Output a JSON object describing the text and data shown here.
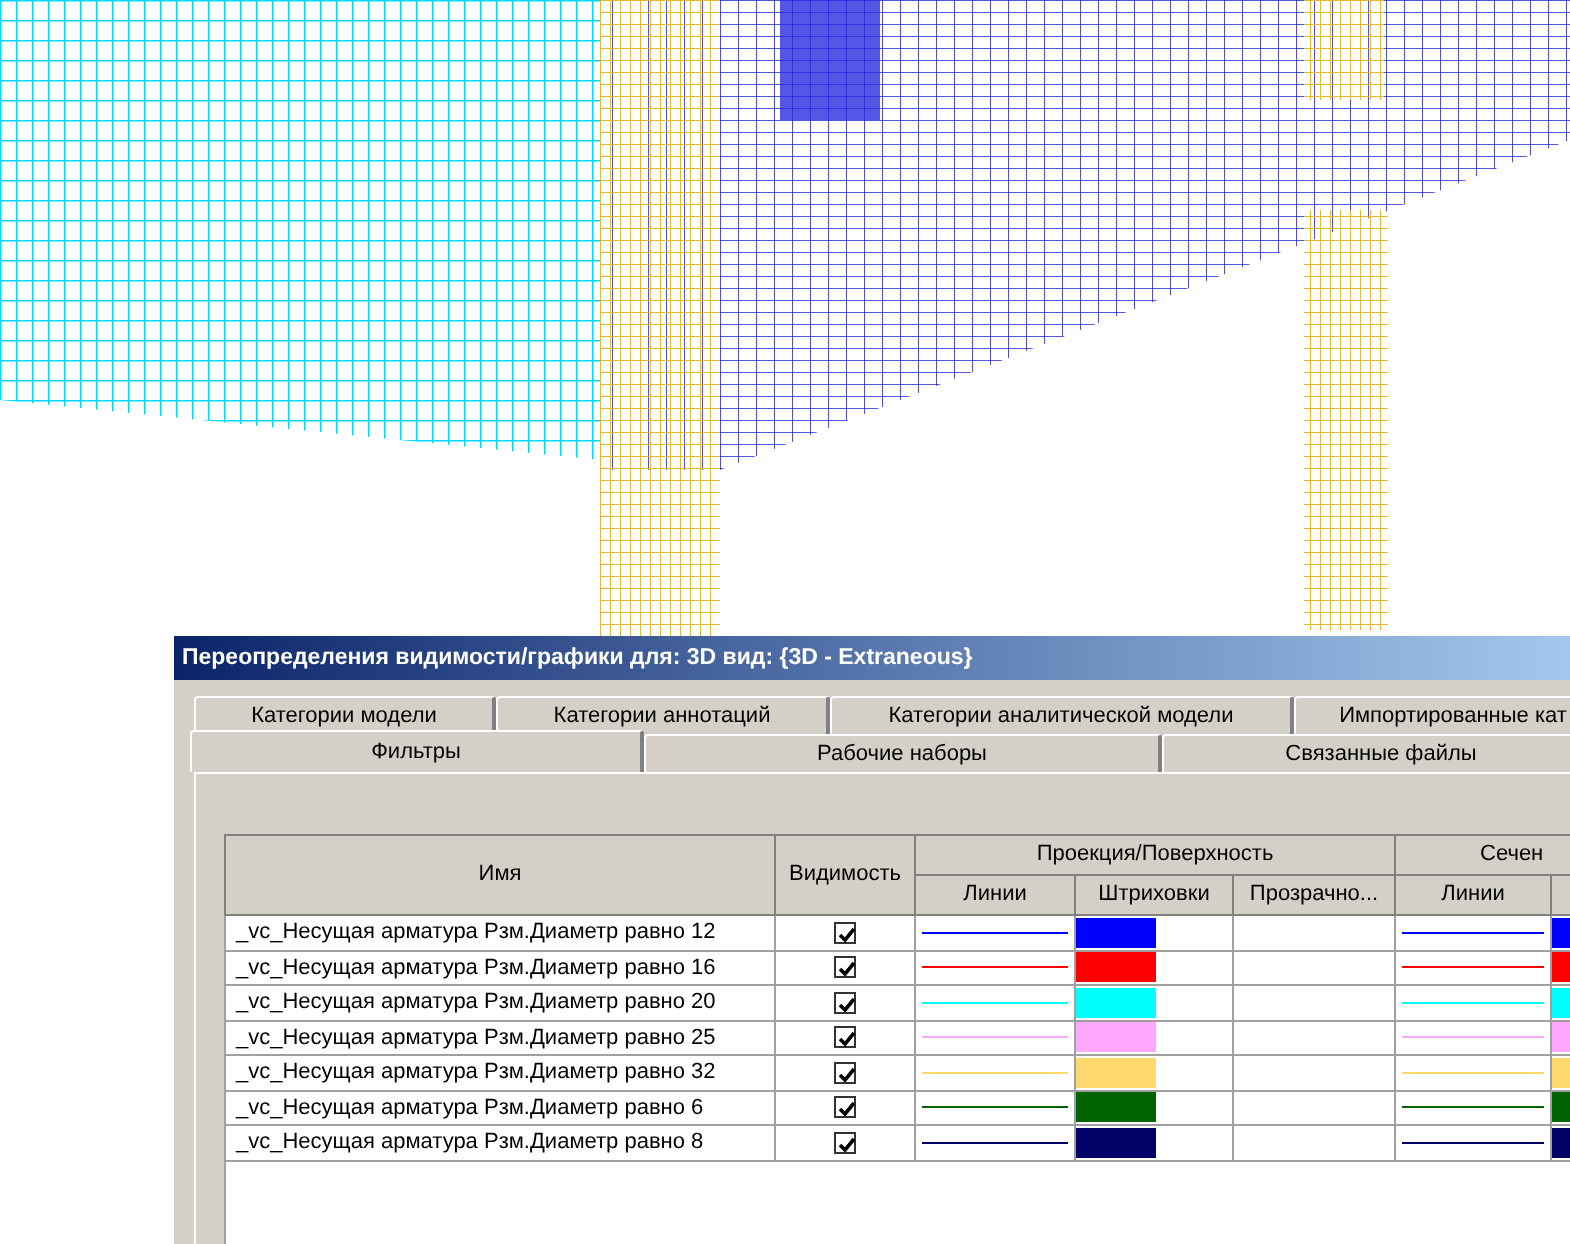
{
  "window": {
    "title": "Переопределения видимости/графики для: 3D вид: {3D - Extraneous}"
  },
  "tabs_row_1": [
    {
      "label": "Категории модели",
      "selected": false
    },
    {
      "label": "Категории аннотаций",
      "selected": false
    },
    {
      "label": "Категории аналитической модели",
      "selected": false
    },
    {
      "label": "Импортированные кат",
      "selected": false
    }
  ],
  "tabs_row_2": [
    {
      "label": "Фильтры",
      "selected": true
    },
    {
      "label": "Рабочие наборы",
      "selected": false
    },
    {
      "label": "Связанные файлы",
      "selected": false
    }
  ],
  "table": {
    "columns": {
      "name": "Имя",
      "visibility": "Видимость",
      "groups": [
        {
          "label": "Проекция/Поверхность",
          "subcolumns": [
            "Линии",
            "Штриховки",
            "Прозрачно..."
          ]
        },
        {
          "label": "Сечен",
          "subcolumns": [
            "Линии"
          ]
        }
      ]
    },
    "rows": [
      {
        "name": "_vc_Несущая арматура Рзм.Диаметр равно 12",
        "visible": true,
        "color": "#0000ff"
      },
      {
        "name": "_vc_Несущая арматура Рзм.Диаметр равно 16",
        "visible": true,
        "color": "#ff0000"
      },
      {
        "name": "_vc_Несущая арматура Рзм.Диаметр равно 20",
        "visible": true,
        "color": "#00ffff"
      },
      {
        "name": "_vc_Несущая арматура Рзм.Диаметр равно 25",
        "visible": true,
        "color": "#ffa6ff"
      },
      {
        "name": "_vc_Несущая арматура Рзм.Диаметр равно 32",
        "visible": true,
        "color": "#ffd86e"
      },
      {
        "name": "_vc_Несущая арматура Рзм.Диаметр равно 6",
        "visible": true,
        "color": "#006400"
      },
      {
        "name": "_vc_Несущая арматура Рзм.Диаметр равно 8",
        "visible": true,
        "color": "#000066"
      }
    ]
  }
}
